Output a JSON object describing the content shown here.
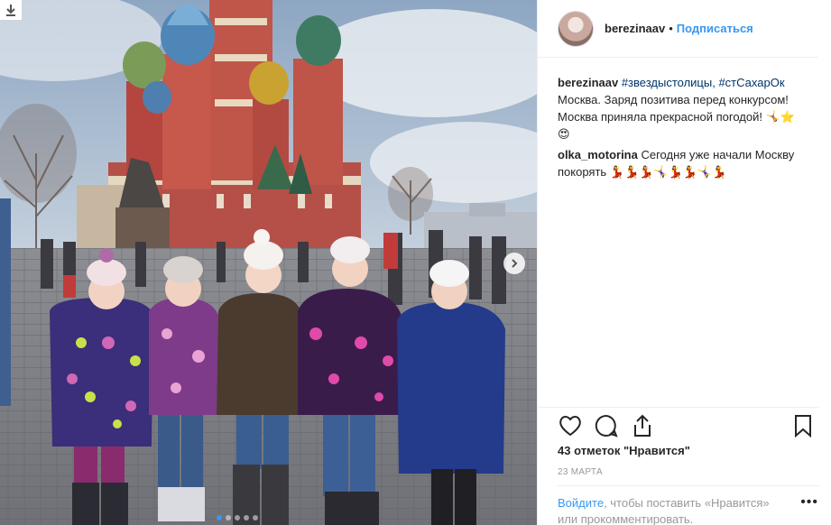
{
  "post": {
    "username": "berezinaav",
    "separator": "•",
    "follow_label": "Подписаться",
    "caption": {
      "author": "berezinaav",
      "tags": "#звездыстолицы, #стСахарОк",
      "line1": "Москва. Заряд позитива перед конкурсом!",
      "line2": "Москва приняла прекрасной погодой! 🤸⭐",
      "line3": "😍"
    },
    "comments": [
      {
        "author": "olka_motorina",
        "text": "Сегодня уже начали Москву",
        "text2": "покорять 💃💃💃🤸‍♀️💃💃🤸‍♀️💃"
      }
    ],
    "likes": "43 отметок \"Нравится\"",
    "date": "23 МАРТА",
    "footer": {
      "login": "Войдите",
      "text1": ", чтобы поставить «Нравится»",
      "text2": "или прокомментировать."
    },
    "more": "•••"
  },
  "icons": {
    "download": "download-icon",
    "next": "chevron-right-icon",
    "like": "heart-icon",
    "comment": "comment-icon",
    "share": "share-icon",
    "save": "bookmark-icon"
  },
  "colors": {
    "link": "#3897f0",
    "tag": "#003569",
    "muted": "#999999"
  },
  "carousel": {
    "count": 5,
    "active": 1
  }
}
